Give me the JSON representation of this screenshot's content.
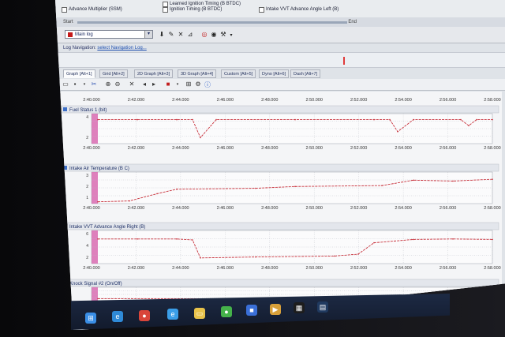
{
  "params": {
    "col1": [
      "Advance Multiplier (SSM)"
    ],
    "col2": [
      "Learned Ignition Timing (B BTDC)",
      "Ignition Timing (B BTDC)"
    ],
    "col3": [
      "Intake VVT Advance Angle Left (B)"
    ]
  },
  "start_row": {
    "label": "Start",
    "end_label": "End"
  },
  "toolbar1": {
    "log_name": "Main log"
  },
  "navigation": {
    "label": "Log Navigation:",
    "value": "select Navigation Log..."
  },
  "tabs": [
    "Graph [Alt+1]",
    "Grid [Alt+2]",
    "2D Graph [Alt+3]",
    "3D Graph [Alt+4]",
    "Custom [Alt+5]",
    "Dyno [Alt+6]",
    "Dash [Alt+7]"
  ],
  "colors": {
    "trace": "#c8313b",
    "marker": "#d86ab0",
    "grid": "#b9bcc4"
  },
  "chart_data": [
    {
      "type": "line",
      "title": "Fuel Status 1 (bit)",
      "x_ticks": [
        "2:40.000",
        "2:42.000",
        "2:44.000",
        "2:46.000",
        "2:48.000",
        "2:50.000",
        "2:52.000",
        "2:54.000",
        "2:56.000",
        "2:58.000"
      ],
      "y_ticks": [
        "4",
        "2"
      ],
      "x": [
        0,
        0.1,
        0.2,
        0.24,
        0.26,
        0.3,
        0.5,
        0.7,
        0.74,
        0.76,
        0.8,
        0.92,
        0.94,
        0.96,
        1
      ],
      "y": [
        4,
        4,
        4,
        4,
        1,
        4,
        4,
        4,
        4,
        2,
        4,
        4,
        3,
        4,
        4
      ],
      "ylim": [
        0,
        5
      ]
    },
    {
      "type": "line",
      "title": "Intake Air Temperature (B C)",
      "x_ticks": [
        "2:40.000",
        "2:42.000",
        "2:44.000",
        "2:46.000",
        "2:48.000",
        "2:50.000",
        "2:52.000",
        "2:54.000",
        "2:56.000",
        "2:58.000"
      ],
      "y_ticks": [
        "3",
        "2",
        "1"
      ],
      "x": [
        0,
        0.08,
        0.15,
        0.2,
        0.4,
        0.5,
        0.72,
        0.8,
        0.9,
        1
      ],
      "y": [
        0.2,
        0.3,
        1.1,
        1.6,
        1.7,
        1.9,
        2.0,
        2.6,
        2.5,
        2.7
      ],
      "ylim": [
        0,
        3.5
      ]
    },
    {
      "type": "line",
      "title": "Intake VVT Advance Angle Right (B)",
      "x_ticks": [
        "2:40.000",
        "2:42.000",
        "2:44.000",
        "2:46.000",
        "2:48.000",
        "2:50.000",
        "2:52.000",
        "2:54.000",
        "2:56.000",
        "2:58.000"
      ],
      "y_ticks": [
        "6",
        "4",
        "2"
      ],
      "x": [
        0,
        0.1,
        0.2,
        0.24,
        0.26,
        0.4,
        0.6,
        0.66,
        0.7,
        0.8,
        0.9,
        1
      ],
      "y": [
        5.2,
        5.2,
        5.2,
        5.0,
        1.2,
        1.4,
        1.6,
        2.0,
        4.4,
        5.1,
        5.2,
        5.1
      ],
      "ylim": [
        0,
        7
      ]
    },
    {
      "type": "line",
      "title": "Knock Signal #2 (On/Off)",
      "x_ticks": [],
      "y_ticks": [],
      "x": [
        0,
        1
      ],
      "y": [
        0.2,
        0.2
      ],
      "ylim": [
        0,
        1
      ]
    }
  ],
  "taskbar": {
    "icons": [
      {
        "name": "windows-start-icon",
        "color": "#3a8ee6",
        "glyph": "⊞"
      },
      {
        "name": "edge-icon",
        "color": "#2f8ad8",
        "glyph": "e"
      },
      {
        "name": "chrome-icon",
        "color": "#d9453a",
        "glyph": "●"
      },
      {
        "name": "ie-icon",
        "color": "#3b9ee8",
        "glyph": "e"
      },
      {
        "name": "file-explorer-icon",
        "color": "#e8c24a",
        "glyph": "▭"
      },
      {
        "name": "green-app-icon",
        "color": "#45b24a",
        "glyph": "●"
      },
      {
        "name": "blue-app-icon",
        "color": "#3a6fd8",
        "glyph": "■"
      },
      {
        "name": "orange-app-icon",
        "color": "#d8a03a",
        "glyph": "▶"
      },
      {
        "name": "terminal-app-icon",
        "color": "#1d1d1d",
        "glyph": "▦"
      },
      {
        "name": "dark-app-icon",
        "color": "#203a60",
        "glyph": "▤"
      }
    ]
  }
}
